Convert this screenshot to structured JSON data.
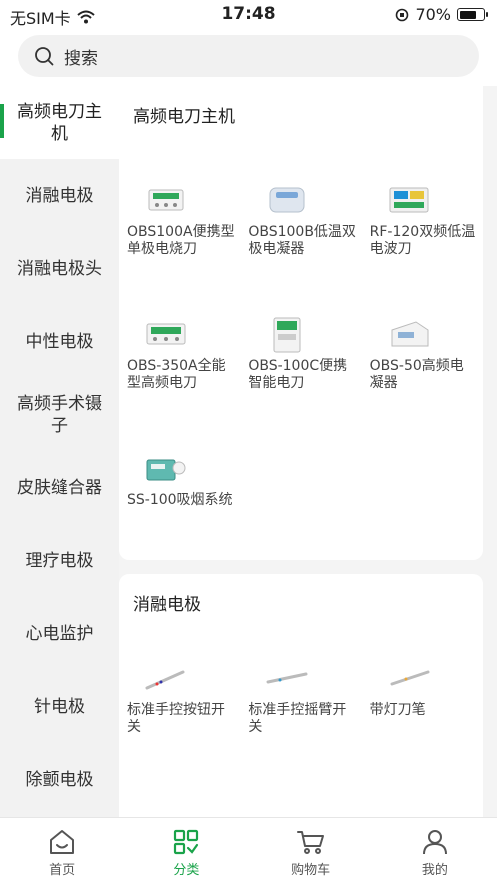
{
  "status_bar": {
    "carrier": "无SIM卡",
    "time": "17:48",
    "battery": "70%",
    "battery_level": 0.7
  },
  "search": {
    "placeholder": "搜索"
  },
  "sidebar": {
    "items": [
      {
        "label": "高频电刀主机"
      },
      {
        "label": "消融电极"
      },
      {
        "label": "消融电极头"
      },
      {
        "label": "中性电极"
      },
      {
        "label": "高频手术镊子"
      },
      {
        "label": "皮肤缝合器"
      },
      {
        "label": "理疗电极"
      },
      {
        "label": "心电监护"
      },
      {
        "label": "针电极"
      },
      {
        "label": "除颤电极"
      }
    ]
  },
  "sections": [
    {
      "title": "高频电刀主机",
      "products": [
        {
          "name": "OBS100A便携型单极电烧刀"
        },
        {
          "name": "OBS100B低温双极电凝器"
        },
        {
          "name": "RF-120双频低温电波刀"
        },
        {
          "name": "OBS-350A全能型高频电刀"
        },
        {
          "name": "OBS-100C便携智能电刀"
        },
        {
          "name": "OBS-50高频电凝器"
        },
        {
          "name": "SS-100吸烟系统"
        }
      ]
    },
    {
      "title": "消融电极",
      "products": [
        {
          "name": "标准手控按钮开关"
        },
        {
          "name": "标准手控摇臂开关"
        },
        {
          "name": "带灯刀笔"
        }
      ]
    }
  ],
  "tabbar": {
    "tabs": [
      {
        "label": "首页",
        "icon": "home-icon"
      },
      {
        "label": "分类",
        "icon": "category-icon"
      },
      {
        "label": "购物车",
        "icon": "cart-icon"
      },
      {
        "label": "我的",
        "icon": "profile-icon"
      }
    ],
    "active": "分类"
  },
  "colors": {
    "accent": "#1aa34a",
    "background": "#f4f4f4"
  }
}
